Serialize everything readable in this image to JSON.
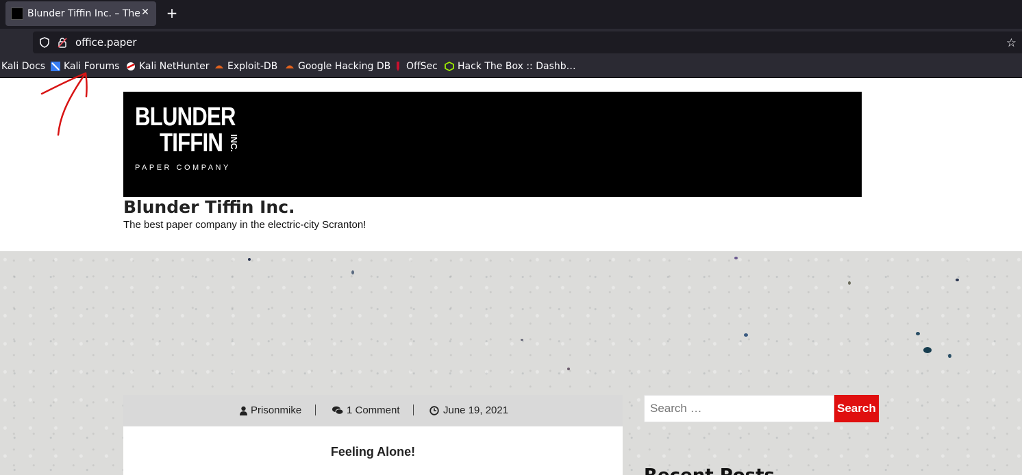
{
  "browser": {
    "tab": {
      "title": "Blunder Tiffin Inc. – The b",
      "favicon_text": "BLUNDER TIFFIN"
    },
    "new_tab_icon": "plus-icon",
    "url": "office.paper",
    "bookmarks": [
      {
        "label": "Kali Docs",
        "icon": ""
      },
      {
        "label": "Kali Forums",
        "icon": "kali-forums-icon"
      },
      {
        "label": "Kali NetHunter",
        "icon": "nethunter-icon"
      },
      {
        "label": "Exploit-DB",
        "icon": "exploitdb-icon"
      },
      {
        "label": "Google Hacking DB",
        "icon": "ghdb-icon"
      },
      {
        "label": "OffSec",
        "icon": "offsec-icon"
      },
      {
        "label": "Hack The Box :: Dashb…",
        "icon": "htb-icon"
      }
    ]
  },
  "site": {
    "logo": {
      "line1": "BLUNDER",
      "line2": "TIFFIN",
      "inc": "INC.",
      "sub": "PAPER COMPANY"
    },
    "title": "Blunder Tiffin Inc.",
    "description": "The best paper company in the electric-city Scranton!"
  },
  "post": {
    "author": "Prisonmike",
    "comments": "1 Comment",
    "date": "June 19, 2021",
    "title": "Feeling Alone!"
  },
  "sidebar": {
    "search_placeholder": "Search …",
    "search_button": "Search",
    "recent_posts_heading": "Recent Posts"
  },
  "colors": {
    "search_button": "#e00f0f",
    "tabbar": "#1c1b22",
    "toolbar": "#2b2a33",
    "annotation": "#d81414"
  }
}
